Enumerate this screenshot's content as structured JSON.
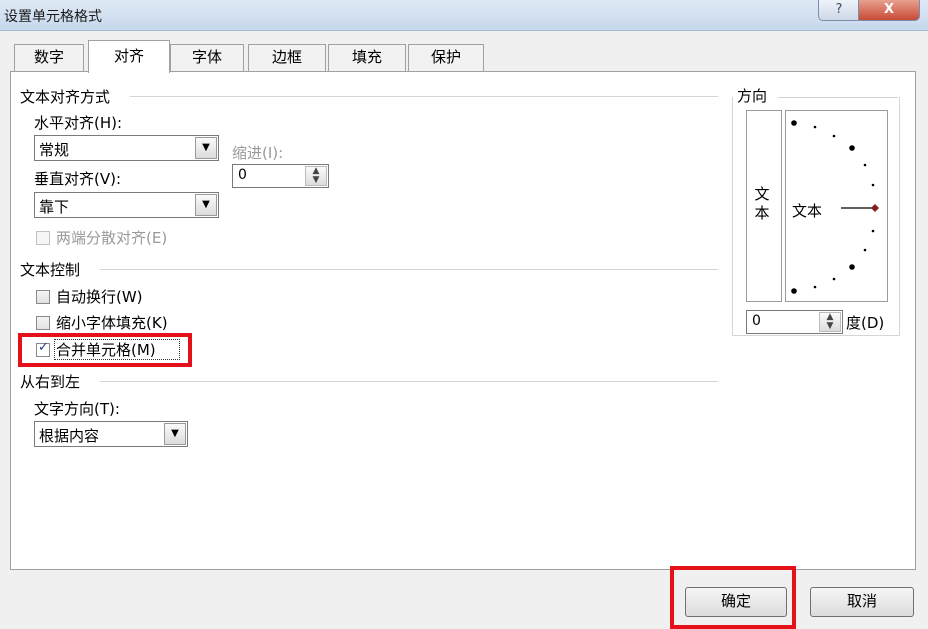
{
  "window": {
    "title": "设置单元格格式",
    "help": "?",
    "close": "X"
  },
  "tabs": [
    {
      "label": "数字"
    },
    {
      "label": "对齐"
    },
    {
      "label": "字体"
    },
    {
      "label": "边框"
    },
    {
      "label": "填充"
    },
    {
      "label": "保护"
    }
  ],
  "alignment": {
    "section_title": "文本对齐方式",
    "horizontal_label": "水平对齐(H):",
    "horizontal_value": "常规",
    "indent_label": "缩进(I):",
    "indent_value": "0",
    "vertical_label": "垂直对齐(V):",
    "vertical_value": "靠下",
    "distributed_label": "两端分散对齐(E)"
  },
  "text_control": {
    "section_title": "文本控制",
    "wrap_label": "自动换行(W)",
    "shrink_label": "缩小字体填充(K)",
    "merge_label": "合并单元格(M)",
    "merge_checked": true
  },
  "rtl": {
    "section_title": "从右到左",
    "direction_label": "文字方向(T):",
    "direction_value": "根据内容"
  },
  "orientation": {
    "title": "方向",
    "vertical_text": "文本",
    "dial_text": "文本",
    "degree_value": "0",
    "degree_label": "度(D)"
  },
  "buttons": {
    "ok": "确定",
    "cancel": "取消"
  },
  "colors": {
    "highlight": "#e4101a",
    "dial_point": "#8b1a1a"
  }
}
